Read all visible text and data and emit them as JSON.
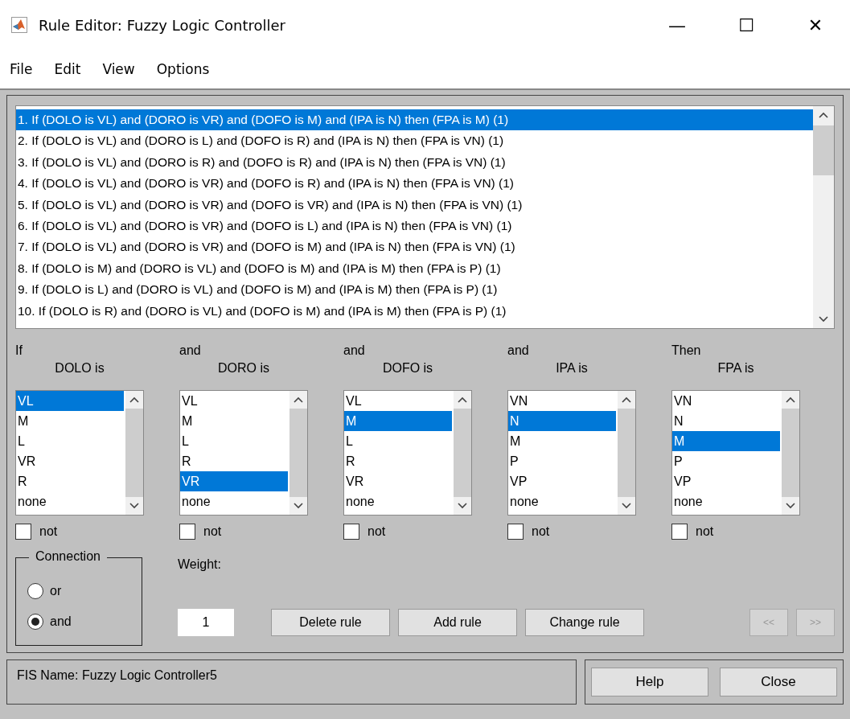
{
  "window": {
    "title": "Rule Editor: Fuzzy Logic Controller",
    "controls": [
      "—",
      "☐",
      "✕"
    ]
  },
  "menu": [
    "File",
    "Edit",
    "View",
    "Options"
  ],
  "rules": [
    {
      "text": "1. If (DOLO is VL) and (DORO is VR) and (DOFO is M) and (IPA is N) then (FPA is M) (1)",
      "selected": true
    },
    {
      "text": "2. If (DOLO is VL) and (DORO is L) and (DOFO is R) and (IPA is N) then (FPA is VN) (1)",
      "selected": false
    },
    {
      "text": "3. If (DOLO is VL) and (DORO is R) and (DOFO is R) and (IPA is N) then (FPA is VN) (1)",
      "selected": false
    },
    {
      "text": "4. If (DOLO is VL) and (DORO is VR) and (DOFO is R) and (IPA is N) then (FPA is VN) (1)",
      "selected": false
    },
    {
      "text": "5. If (DOLO is VL) and (DORO is VR) and (DOFO is VR) and (IPA is N) then (FPA is VN) (1)",
      "selected": false
    },
    {
      "text": "6. If (DOLO is VL) and (DORO is VR) and (DOFO is L) and (IPA is N) then (FPA is VN) (1)",
      "selected": false
    },
    {
      "text": "7. If (DOLO is VL) and (DORO is VR) and (DOFO is M) and (IPA is N) then (FPA is VN) (1)",
      "selected": false
    },
    {
      "text": "8. If (DOLO is M) and (DORO is VL) and (DOFO is M) and (IPA is M) then (FPA is P) (1)",
      "selected": false
    },
    {
      "text": "9. If (DOLO is L) and (DORO is VL) and (DOFO is M) and (IPA is M) then (FPA is P) (1)",
      "selected": false
    },
    {
      "text": "10. If (DOLO is R) and (DORO is VL) and (DOFO is M) and (IPA is M) then (FPA is P) (1)",
      "selected": false
    }
  ],
  "variables": [
    {
      "connector": "If",
      "label": "DOLO is",
      "not": false,
      "options": [
        {
          "label": "VL",
          "selected": true
        },
        {
          "label": "M",
          "selected": false
        },
        {
          "label": "L",
          "selected": false
        },
        {
          "label": "VR",
          "selected": false
        },
        {
          "label": "R",
          "selected": false
        },
        {
          "label": "none",
          "selected": false
        }
      ],
      "not_label": "not"
    },
    {
      "connector": "and",
      "label": "DORO is",
      "not": false,
      "options": [
        {
          "label": "VL",
          "selected": false
        },
        {
          "label": "M",
          "selected": false
        },
        {
          "label": "L",
          "selected": false
        },
        {
          "label": "R",
          "selected": false
        },
        {
          "label": "VR",
          "selected": true
        },
        {
          "label": "none",
          "selected": false
        }
      ],
      "not_label": "not"
    },
    {
      "connector": "and",
      "label": "DOFO is",
      "not": false,
      "options": [
        {
          "label": "VL",
          "selected": false
        },
        {
          "label": "M",
          "selected": true
        },
        {
          "label": "L",
          "selected": false
        },
        {
          "label": "R",
          "selected": false
        },
        {
          "label": "VR",
          "selected": false
        },
        {
          "label": "none",
          "selected": false
        }
      ],
      "not_label": "not"
    },
    {
      "connector": "and",
      "label": "IPA is",
      "not": false,
      "options": [
        {
          "label": "VN",
          "selected": false
        },
        {
          "label": "N",
          "selected": true
        },
        {
          "label": "M",
          "selected": false
        },
        {
          "label": "P",
          "selected": false
        },
        {
          "label": "VP",
          "selected": false
        },
        {
          "label": "none",
          "selected": false
        }
      ],
      "not_label": "not"
    },
    {
      "connector": "Then",
      "label": "FPA is",
      "not": false,
      "options": [
        {
          "label": "VN",
          "selected": false
        },
        {
          "label": "N",
          "selected": false
        },
        {
          "label": "M",
          "selected": true
        },
        {
          "label": "P",
          "selected": false
        },
        {
          "label": "VP",
          "selected": false
        },
        {
          "label": "none",
          "selected": false
        }
      ],
      "not_label": "not"
    }
  ],
  "connection": {
    "title": "Connection",
    "options": [
      {
        "label": "or",
        "selected": false
      },
      {
        "label": "and",
        "selected": true
      }
    ]
  },
  "weight": {
    "label": "Weight:",
    "value": "1"
  },
  "buttons": [
    "Delete rule",
    "Add rule",
    "Change rule"
  ],
  "nav": [
    {
      "label": "<<",
      "disabled": true
    },
    {
      "label": ">>",
      "disabled": true
    }
  ],
  "status": "FIS Name: Fuzzy Logic Controller5",
  "footer_buttons": [
    "Help",
    "Close"
  ]
}
